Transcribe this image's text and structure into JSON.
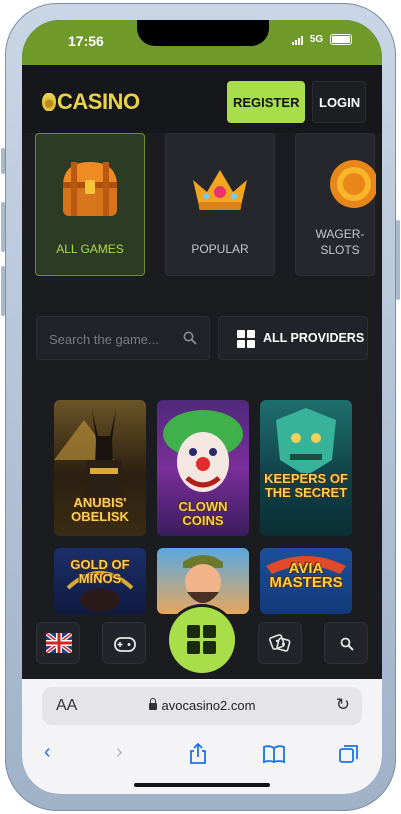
{
  "status": {
    "time": "17:56",
    "network": "5G"
  },
  "header": {
    "logo": "CASINO",
    "register_label": "REGISTER",
    "login_label": "LOGIN"
  },
  "categories": [
    {
      "label": "ALL GAMES",
      "icon": "chest-icon",
      "active": true
    },
    {
      "label": "POPULAR",
      "icon": "crown-icon",
      "active": false
    },
    {
      "label": "WAGER-\nSLOTS",
      "icon": "coin-icon",
      "active": false
    }
  ],
  "search": {
    "placeholder": "Search the game...",
    "providers_label": "ALL PROVIDERS"
  },
  "games": [
    {
      "name": "ANUBIS' OBELISK"
    },
    {
      "name": "CLOWN COINS"
    },
    {
      "name": "KEEPERS OF THE SECRET"
    },
    {
      "name": "GOLD OF MINOS"
    },
    {
      "name": ""
    },
    {
      "name": "AVIA MASTERS"
    }
  ],
  "bottom_nav": {
    "icons": [
      "uk-flag-icon",
      "gamepad-icon",
      "grid-icon",
      "dice-icon",
      "search-icon"
    ]
  },
  "browser": {
    "aa_label": "AA",
    "url": "avocasino2.com"
  },
  "colors": {
    "accent": "#a8de4a",
    "status_bar": "#6f9a2a",
    "background": "#1b1c20",
    "link": "#1a73e8"
  }
}
